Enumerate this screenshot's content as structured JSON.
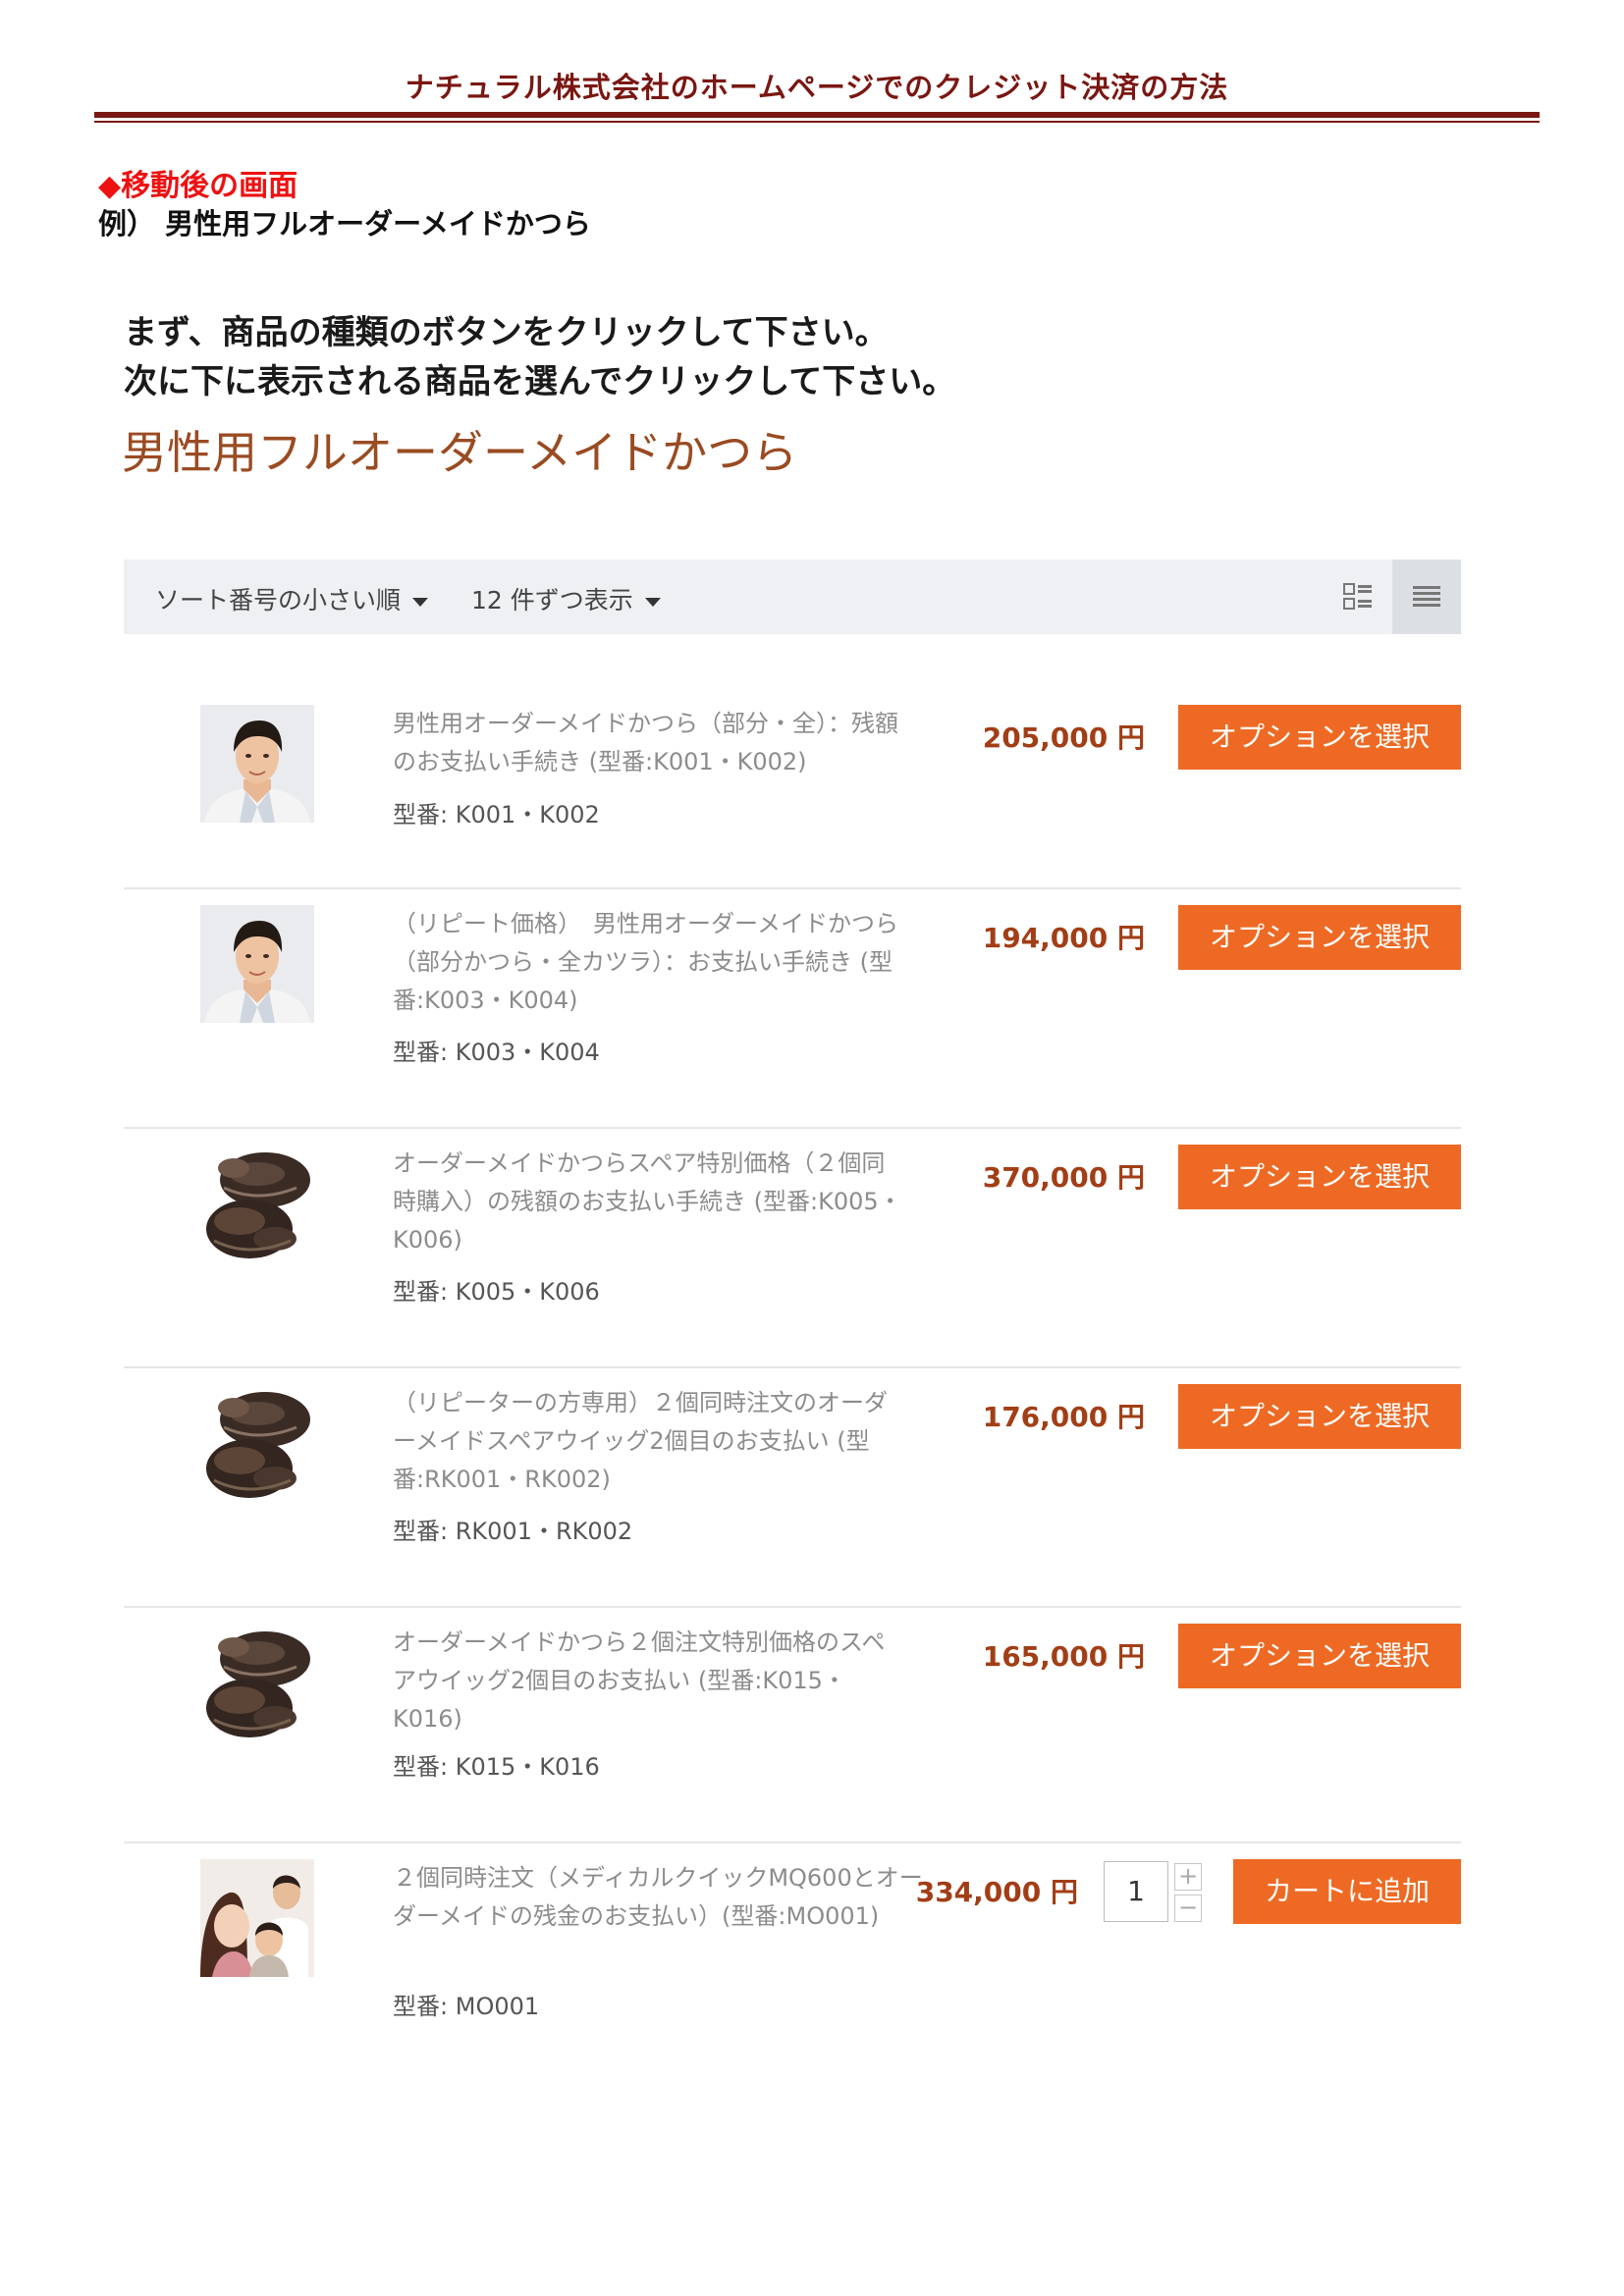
{
  "doc_header": "ナチュラル株式会社のホームページでのクレジット決済の方法",
  "section_heading": "◆移動後の画面",
  "example_line": "例） 男性用フルオーダーメイドかつら",
  "instructions": {
    "line1": "まず、商品の種類のボタンをクリックして下さい。",
    "line2": "次に下に表示される商品を選んでクリックして下さい。"
  },
  "category_title": "男性用フルオーダーメイドかつら",
  "toolbar": {
    "sort_label": "ソート番号の小さい順",
    "per_page_label": "12 件ずつ表示",
    "grid_view_icon": "grid-view-icon",
    "list_view_icon": "list-view-icon"
  },
  "sku_prefix": "型番:",
  "products": [
    {
      "name": "男性用オーダーメイドかつら（部分・全）：残額のお支払い手続き (型番:K001・K002)",
      "sku": "K001・K002",
      "price": "205,000 円",
      "button": "オプションを選択",
      "thumb": "man-portrait"
    },
    {
      "name": "（リピート価格）　男性用オーダーメイドかつら（部分かつら・全カツラ）：お支払い手続き (型番:K003・K004)",
      "sku": "K003・K004",
      "price": "194,000 円",
      "button": "オプションを選択",
      "thumb": "man-portrait"
    },
    {
      "name": "オーダーメイドかつらスペア特別価格（２個同時購入）の残額のお支払い手続き (型番:K005・K006)",
      "sku": "K005・K006",
      "price": "370,000 円",
      "button": "オプションを選択",
      "thumb": "wig-photo"
    },
    {
      "name": "（リピーターの方専用）２個同時注文のオーダーメイドスペアウイッグ2個目のお支払い (型番:RK001・RK002)",
      "sku": "RK001・RK002",
      "price": "176,000 円",
      "button": "オプションを選択",
      "thumb": "wig-photo"
    },
    {
      "name": "オーダーメイドかつら２個注文特別価格のスペアウイッグ2個目のお支払い (型番:K015・K016)",
      "sku": "K015・K016",
      "price": "165,000 円",
      "button": "オプションを選択",
      "thumb": "wig-photo"
    },
    {
      "name": "２個同時注文（メディカルクイックMQ600とオーダーメイドの残金のお支払い）(型番:MO001)",
      "sku": "MO001",
      "price": "334,000 円",
      "quantity": "1",
      "button": "カートに追加",
      "thumb": "group-photo"
    }
  ]
}
